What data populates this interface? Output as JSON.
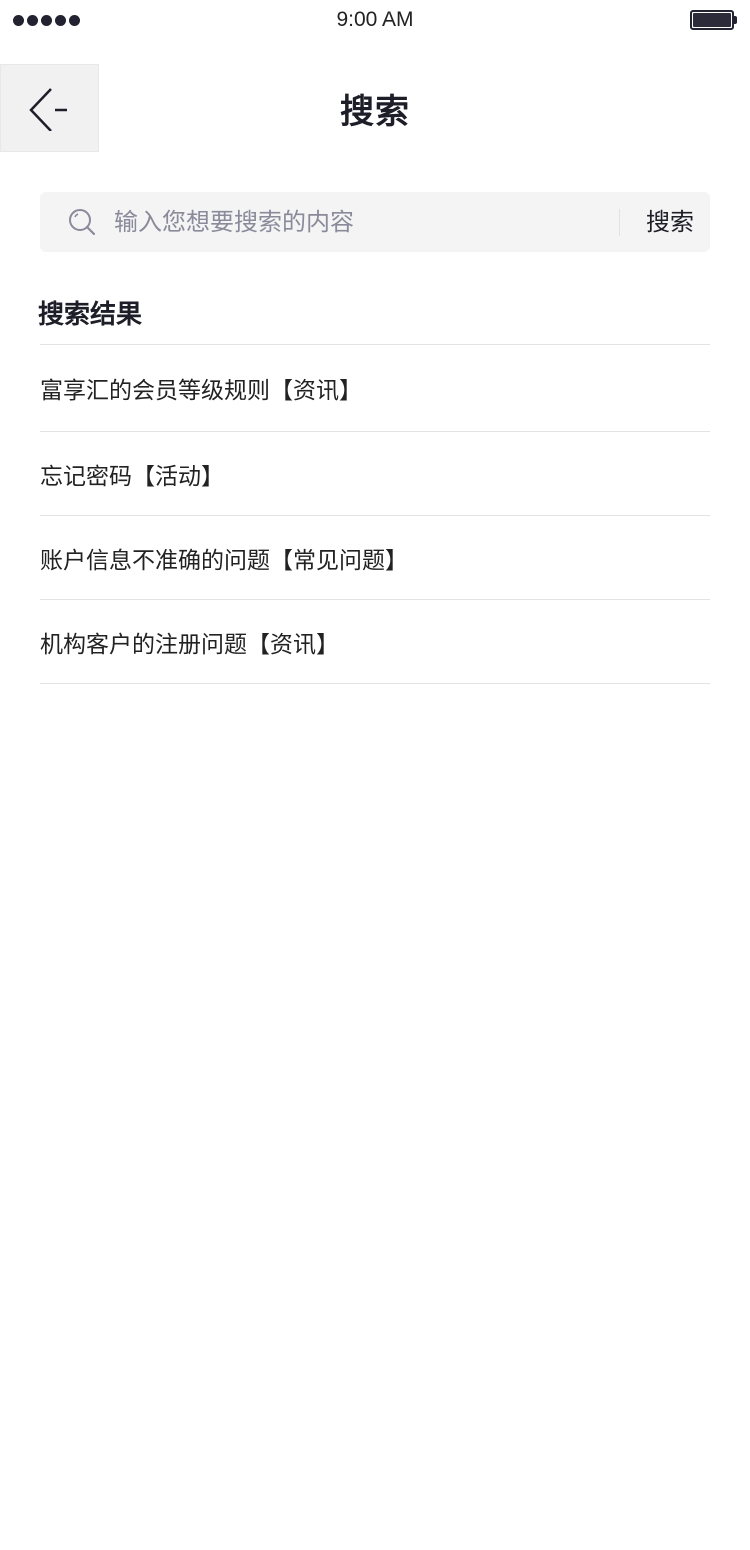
{
  "status_bar": {
    "time": "9:00 AM",
    "signal_dots": 5
  },
  "nav": {
    "back_icon": "back-arrow-icon",
    "title": "搜索"
  },
  "search": {
    "icon": "search-icon",
    "placeholder": "输入您想要搜索的内容",
    "value": "",
    "button_label": "搜索"
  },
  "results": {
    "heading": "搜索结果",
    "items": [
      {
        "label": "富享汇的会员等级规则【资讯】"
      },
      {
        "label": "忘记密码【活动】"
      },
      {
        "label": "账户信息不准确的问题【常见问题】"
      },
      {
        "label": "机构客户的注册问题【资讯】"
      }
    ]
  },
  "colors": {
    "search_bg": "#f4f4f5",
    "divider": "#e3e3e6",
    "text_primary": "#1e1e28",
    "placeholder": "#8a8a9a"
  }
}
